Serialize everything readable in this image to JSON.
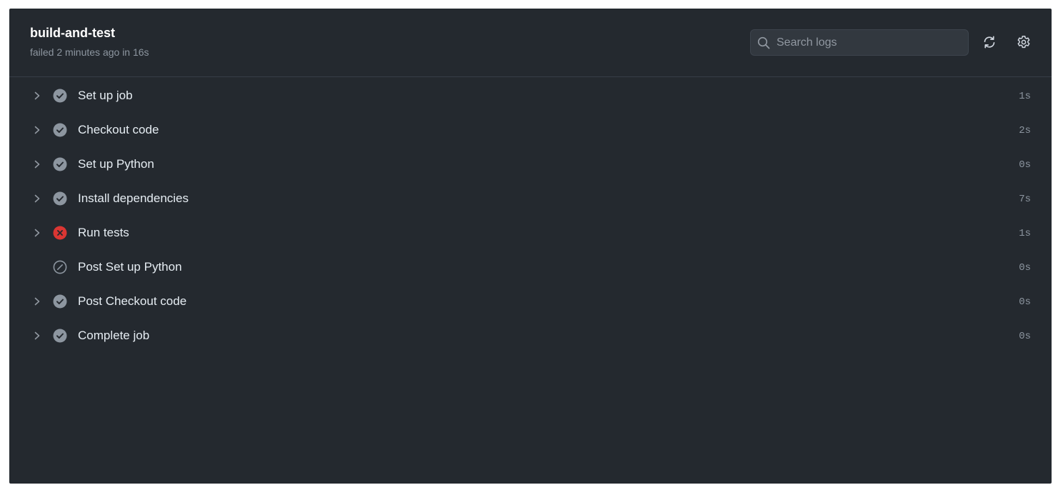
{
  "job": {
    "title": "build-and-test",
    "subtitle": "failed 2 minutes ago in 16s"
  },
  "search": {
    "placeholder": "Search logs",
    "value": ""
  },
  "toolbar": {
    "refresh_icon": "refresh-icon",
    "settings_icon": "gear-icon"
  },
  "colors": {
    "panel_bg": "#24292f",
    "success_gray": "#8d96a0",
    "failure_red": "#da3633",
    "text": "#e6edf3",
    "muted": "#8d96a0"
  },
  "steps": [
    {
      "name": "Set up job",
      "duration": "1s",
      "status": "success",
      "expandable": true
    },
    {
      "name": "Checkout code",
      "duration": "2s",
      "status": "success",
      "expandable": true
    },
    {
      "name": "Set up Python",
      "duration": "0s",
      "status": "success",
      "expandable": true
    },
    {
      "name": "Install dependencies",
      "duration": "7s",
      "status": "success",
      "expandable": true
    },
    {
      "name": "Run tests",
      "duration": "1s",
      "status": "failure",
      "expandable": true
    },
    {
      "name": "Post Set up Python",
      "duration": "0s",
      "status": "skipped",
      "expandable": false
    },
    {
      "name": "Post Checkout code",
      "duration": "0s",
      "status": "success",
      "expandable": true
    },
    {
      "name": "Complete job",
      "duration": "0s",
      "status": "success",
      "expandable": true
    }
  ]
}
